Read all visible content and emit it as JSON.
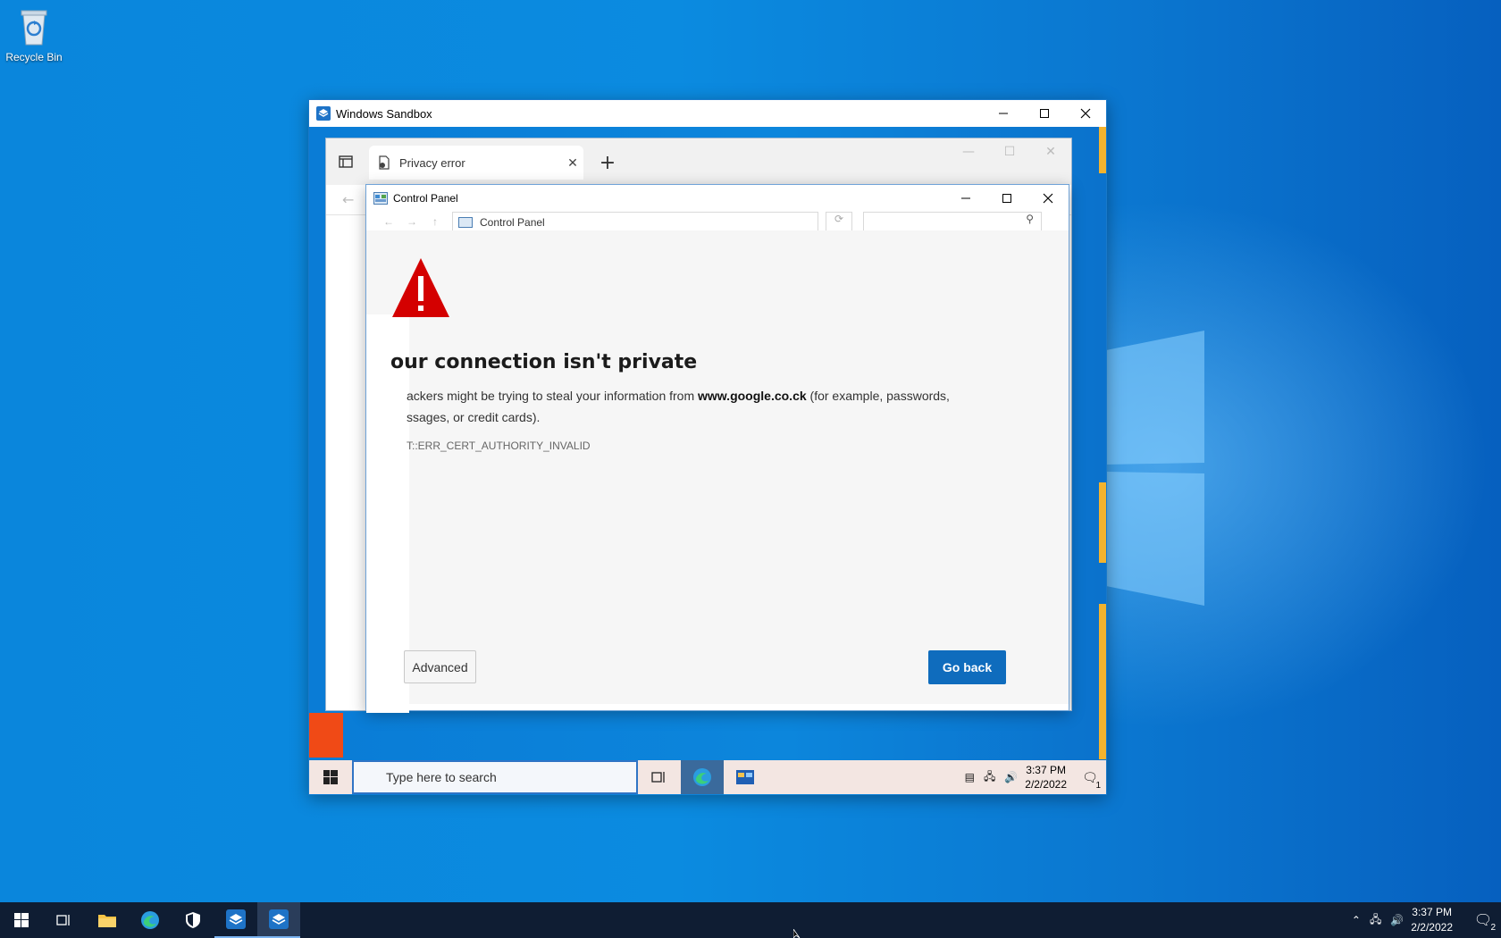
{
  "desktop": {
    "recycle_bin_label": "Recycle Bin"
  },
  "sandbox_window": {
    "title": "Windows Sandbox"
  },
  "edge_browser": {
    "tab_title": "Privacy error",
    "new_tab_symbol": "+"
  },
  "control_panel": {
    "title": "Control Panel",
    "breadcrumb": "Control Panel"
  },
  "error_page": {
    "heading": "our connection isn't private",
    "line1_prefix": "ackers might be trying to steal your information from ",
    "domain": "www.google.co.ck",
    "line1_suffix": " (for example, passwords,",
    "line2": "ssages, or credit cards).",
    "error_code": "T::ERR_CERT_AUTHORITY_INVALID",
    "advanced_label": "Advanced",
    "go_back_label": "Go back"
  },
  "inner_taskbar": {
    "search_placeholder": "Type here to search",
    "time": "3:37 PM",
    "date": "2/2/2022",
    "notification_count": "1"
  },
  "taskbar": {
    "time": "3:37 PM",
    "date": "2/2/2022",
    "notification_count": "2"
  },
  "colors": {
    "accent": "#0f6cbd",
    "warning": "#d40000",
    "desktop": "#0a86dc",
    "taskbar": "#0f1d33"
  }
}
